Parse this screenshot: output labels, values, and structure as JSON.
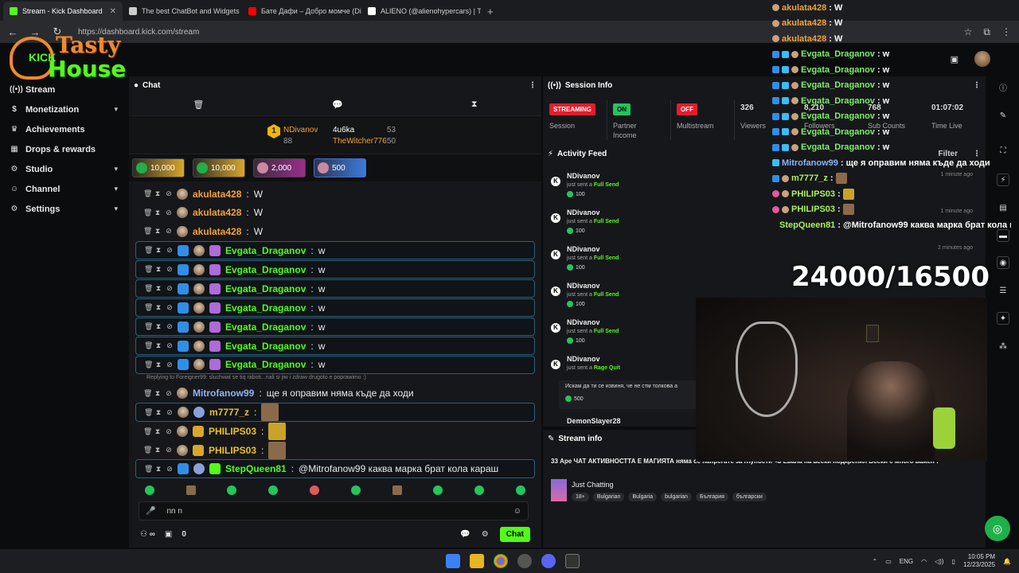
{
  "browser": {
    "tabs": [
      {
        "title": "Stream - Kick Dashboard",
        "color": "#53fc18"
      },
      {
        "title": "The best ChatBot and Widgets",
        "color": "#cccccc"
      },
      {
        "title": "Бате Дафи – Добро момче (Di...",
        "color": "#ff0000"
      },
      {
        "title": "ALIENO (@alienohypercars) | Ti...",
        "color": "#ffffff"
      }
    ],
    "url": "https://dashboard.kick.com/stream"
  },
  "logo": {
    "line1": "Tasty",
    "line2": "House",
    "badge": "KICK"
  },
  "sidebar": {
    "items": [
      {
        "label": "Stream",
        "icon": "broadcast-icon",
        "chevron": false
      },
      {
        "label": "Monetization",
        "icon": "dollar-icon",
        "chevron": true
      },
      {
        "label": "Achievements",
        "icon": "trophy-icon",
        "chevron": false
      },
      {
        "label": "Drops & rewards",
        "icon": "gift-icon",
        "chevron": false
      },
      {
        "label": "Studio",
        "icon": "gear-icon",
        "chevron": true
      },
      {
        "label": "Channel",
        "icon": "person-icon",
        "chevron": true
      },
      {
        "label": "Settings",
        "icon": "settings-icon",
        "chevron": true
      }
    ]
  },
  "chat": {
    "title": "Chat",
    "leaderboard": {
      "rank": "1",
      "top_name": "NDivanov",
      "top_value": "88",
      "second_name": "4u6ka",
      "second_value": "53",
      "third_name": "TheWitcher776",
      "third_value": "50"
    },
    "tips": [
      {
        "amount": "10,000",
        "style": "gold"
      },
      {
        "amount": "10,000",
        "style": "gold"
      },
      {
        "amount": "2,000",
        "style": "purple"
      },
      {
        "amount": "500",
        "style": "blue"
      }
    ],
    "messages": [
      {
        "user": "akulata428",
        "text": "W",
        "color": "orange",
        "hl": false
      },
      {
        "user": "akulata428",
        "text": "W",
        "color": "orange",
        "hl": false
      },
      {
        "user": "akulata428",
        "text": "W",
        "color": "orange",
        "hl": false
      },
      {
        "user": "Evgata_Draganov",
        "text": "w",
        "color": "green",
        "hl": true
      },
      {
        "user": "Evgata_Draganov",
        "text": "w",
        "color": "green",
        "hl": true
      },
      {
        "user": "Evgata_Draganov",
        "text": "w",
        "color": "green",
        "hl": true
      },
      {
        "user": "Evgata_Draganov",
        "text": "w",
        "color": "green",
        "hl": true
      },
      {
        "user": "Evgata_Draganov",
        "text": "w",
        "color": "green",
        "hl": true
      },
      {
        "user": "Evgata_Draganov",
        "text": "w",
        "color": "green",
        "hl": true
      },
      {
        "user": "Evgata_Draganov",
        "text": "w",
        "color": "green",
        "hl": true
      }
    ],
    "reply_hint": "Replying to Foreigner99: sluchwat se tiq raboti...nali si jiw i zdraw drugoto e poprawimo :)",
    "messages2": [
      {
        "user": "Mitrofanow99",
        "text": "ще я оправим няма къде да ходи",
        "color": "blue",
        "hl": false
      },
      {
        "user": "m7777_z",
        "text": "",
        "color": "gold",
        "hl": true,
        "emote": true
      },
      {
        "user": "PHILIPS03",
        "text": "",
        "color": "gold",
        "hl": false,
        "emote": true
      },
      {
        "user": "PHILIPS03",
        "text": "",
        "color": "gold",
        "hl": false,
        "emote": true
      },
      {
        "user": "StepQueen81",
        "text": "@Mitrofanow99 каква марка брат кола караш",
        "color": "green",
        "hl": true
      }
    ],
    "input_value": "nn  n",
    "footer_count": "0",
    "send_label": "Chat"
  },
  "session": {
    "title": "Session Info",
    "streaming_badge": "STREAMING",
    "session_label": "Session",
    "partner_badge": "ON",
    "partner_label": "Partner\nIncome",
    "multistream_badge": "OFF",
    "multistream_label": "Multistream",
    "viewers_value": "326",
    "viewers_label": "Viewers",
    "followers_value": "8,210",
    "followers_label": "Followers",
    "subs_value": "768",
    "subs_label": "Sub Counts",
    "time_value": "01:07:02",
    "time_label": "Time Live"
  },
  "activity": {
    "title": "Activity Feed",
    "filter": "Filter",
    "items": [
      {
        "name": "NDivanov",
        "action": "Full Send",
        "kicks": "100",
        "time": "1 minute ago"
      },
      {
        "name": "NDivanov",
        "action": "Full Send",
        "kicks": "100",
        "time": "1 minute ago"
      },
      {
        "name": "NDivanov",
        "action": "Full Send",
        "kicks": "100",
        "time": "2 minutes ago"
      },
      {
        "name": "NDivanov",
        "action": "Full Send",
        "kicks": "100",
        "time": ""
      },
      {
        "name": "NDivanov",
        "action": "Full Send",
        "kicks": "100",
        "time": ""
      },
      {
        "name": "NDivanov",
        "action": "Rage Quit",
        "kicks": "",
        "time": ""
      }
    ],
    "sent_prefix": "just sent a",
    "last_message": "Искам да ти се извиня, че не стм толкова а",
    "last_kicks": "500",
    "next_name": "DemonSlayer28"
  },
  "stream_info": {
    "title": "Stream info",
    "stream_title": "33 Аре ЧАТ АКТИВНОСТТА Е МАГИЯТА няма се напрегате за глупости <3 Евала на всеки подкрепил Всеки е много важен !",
    "category": "Just Chatting",
    "tags": [
      "18+",
      "Bulgarian",
      "Bulgaria",
      "bulgarian",
      "България",
      "български"
    ]
  },
  "overlay": {
    "goal": "24000/16500",
    "lines": [
      {
        "user": "akulata428",
        "text": "W",
        "color": "orange"
      },
      {
        "user": "akulata428",
        "text": "W",
        "color": "orange"
      },
      {
        "user": "akulata428",
        "text": "W",
        "color": "orange"
      },
      {
        "user": "Evgata_Draganov",
        "text": "w",
        "color": "green"
      },
      {
        "user": "Evgata_Draganov",
        "text": "w",
        "color": "green"
      },
      {
        "user": "Evgata_Draganov",
        "text": "w",
        "color": "green"
      },
      {
        "user": "Evgata_Draganov",
        "text": "w",
        "color": "green"
      },
      {
        "user": "Evgata_Draganov",
        "text": "w",
        "color": "green"
      },
      {
        "user": "Evgata_Draganov",
        "text": "w",
        "color": "green"
      },
      {
        "user": "Evgata_Draganov",
        "text": "w",
        "color": "green"
      },
      {
        "user": "Mitrofanow99",
        "text": "ще я оправим няма къде да ходи",
        "color": "blue"
      },
      {
        "user": "m7777_z",
        "text": "",
        "color": "lgreen"
      },
      {
        "user": "PHILIPS03",
        "text": "",
        "color": "lgreen"
      },
      {
        "user": "PHILIPS03",
        "text": "",
        "color": "lgreen"
      },
      {
        "user": "StepQueen81",
        "text": "@Mitrofanow99 каква марка брат кола ка",
        "color": "lgreen"
      }
    ]
  },
  "taskbar": {
    "lang": "ENG",
    "time": "10:05 PM",
    "date": "12/23/2025"
  }
}
